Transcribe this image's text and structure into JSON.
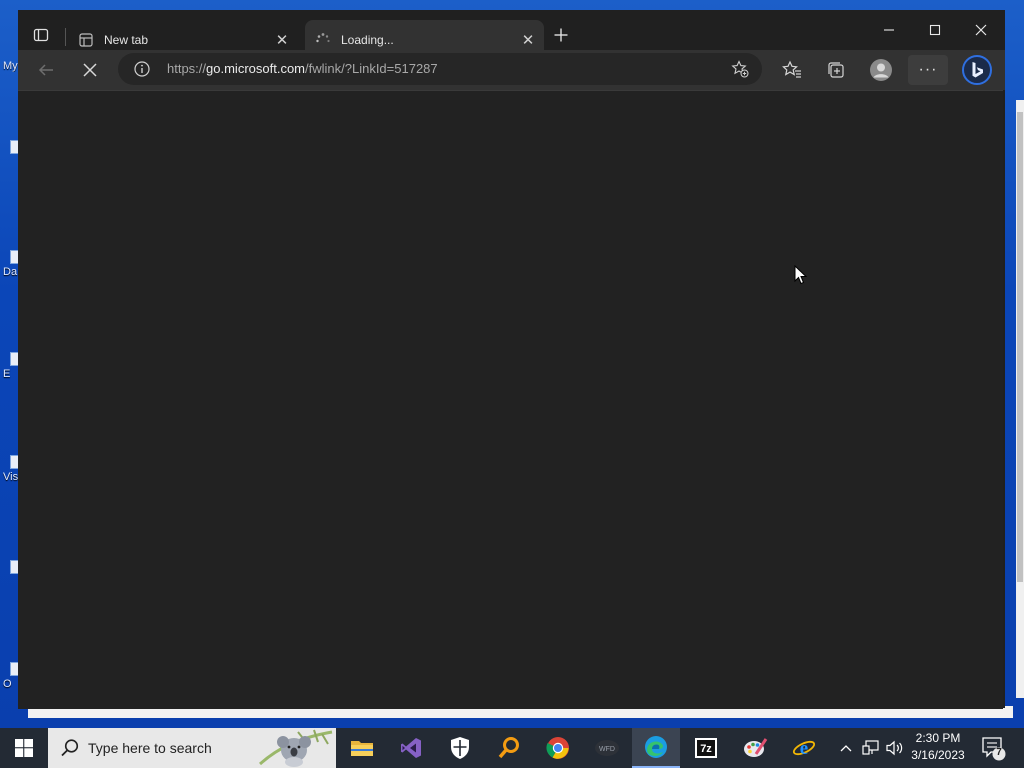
{
  "desktop": {
    "icons": [
      {
        "label": "My"
      },
      {
        "label": "Da"
      },
      {
        "label": "E"
      },
      {
        "label": "Vis"
      },
      {
        "label": "O"
      }
    ]
  },
  "browser": {
    "tabs": [
      {
        "title": "New tab",
        "state": "inactive"
      },
      {
        "title": "Loading...",
        "state": "active-loading"
      }
    ],
    "address": {
      "scheme": "https://",
      "host": "go.microsoft.com",
      "path": "/fwlink/?LinkId=517287"
    },
    "window_controls": {
      "minimize": "minimize",
      "maximize": "maximize",
      "close": "close"
    }
  },
  "taskbar": {
    "search_placeholder": "Type here to search",
    "pinned_apps": [
      "File Explorer",
      "Visual Studio",
      "Windows Security",
      "Search tool",
      "Google Chrome",
      "WFD",
      "Microsoft Edge",
      "7-Zip",
      "Paint",
      "Internet Explorer"
    ],
    "clock": {
      "time": "2:30 PM",
      "date": "3/16/2023"
    },
    "notifications_count": "7"
  },
  "colors": {
    "browser_bg": "#202020",
    "toolbar_bg": "#323232",
    "taskbar_bg": "#232a34",
    "desktop_blue": "#0b46b8"
  }
}
